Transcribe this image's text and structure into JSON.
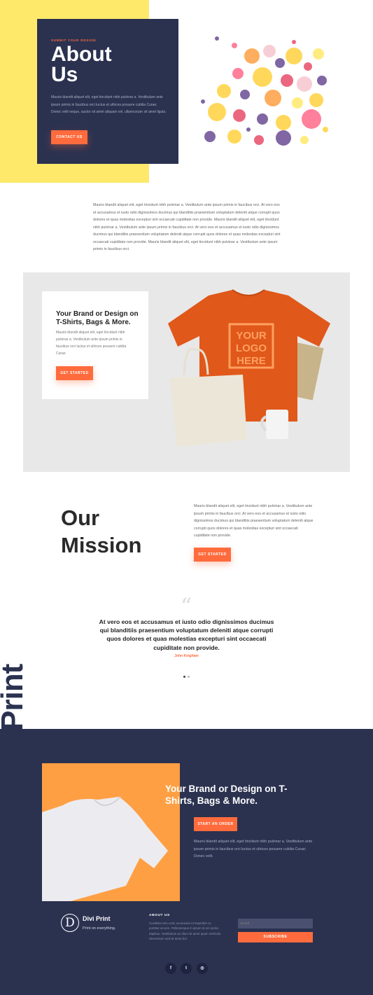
{
  "hero": {
    "eyebrow": "SUBMIT YOUR DESIGN",
    "title": "About Us",
    "text": "Mauris blandit aliquet elit, eget tincidunt nibh pulvinar a. Vestibulum ante ipsum primis in faucibus orci luctus et ultrices posuere cubilia Curae; Donec velit neque, auctor sit amet aliquam vel, ullamcorper sit amet ligula.",
    "button": "CONTACT US"
  },
  "intro": {
    "text": "Mauris blandit aliquet elit, eget tincidunt nibh pulvinar a. Vestibulum ante ipsum primis in faucibus orci. At vero eos et accusamus et iusto odio dignissimos ducimus qui blanditiis praesentium voluptatum deleniti atque corrupti quos dolores et quas molestias excepturi sint occaecati cupiditate non provide. Mauris blandit aliquet elit, eget tincidunt nibh pulvinar a. Vestibulum ante ipsum primis in faucibus orci. At vero eos et accusamus et iusto odio dignissimos ducimus qui blanditiis praesentium voluptatum deleniti atque corrupti quos dolores et quas molestias excepturi sint occaecati cupiditate non provide. Mauris blandit aliquet elit, eget tincidunt nibh pulvinar a. Vestibulum ante ipsum primis in faucibus orci."
  },
  "brand_card": {
    "title": "Your Brand or Design on T-Shirts, Bags & More.",
    "text": "Mauris blandit aliquet elit, eget tincidunt nibh pulvinar a. Vestibulum ante ipsum primis in faucibus orci luctus et ultrices posuere cubilia Curae",
    "button": "GET STARTED",
    "shirt_logo": [
      "YOUR",
      "LOGO",
      "HERE"
    ]
  },
  "mission": {
    "title": "Our Mission",
    "text": "Mauris blandit aliquet elit, eget tincidunt nibh pulvinar a. Vestibulum ante ipsum primis in faucibus orci. At vero eos et accusamus et iusto odio dignissimos ducimus qui blanditiis praesentium voluptatum deleniti atque corrupti quos dolores et quas molestias excepturi sint occaecati cupiditate non provide.",
    "button": "GET STARTED"
  },
  "testimonial": {
    "quote_mark": "“",
    "quote": "At vero eos et accusamus et iusto odio dignissimos ducimus qui blanditiis praesentium voluptatum deleniti atque corrupti quos dolores et quas molestias excepturi sint occaecati cupiditate non provide.",
    "author": "John Kingham"
  },
  "side_word": "Print",
  "cta": {
    "title": "Your Brand or Design on T-Shirts, Bags & More.",
    "button": "START AN ORDER",
    "text": "Mauris blandit aliquet elit, eget tincidunt nibh pulvinar a. Vestibulum ante ipsum primis in faucibus orci luctus et ultrices posuere cubilia Curae; Donec velit."
  },
  "footer": {
    "logo_letter": "D",
    "brand_name": "Divi Print",
    "tagline": "Print on everything.",
    "about_heading": "ABOUT US",
    "about_text": "Curabitur arcu erat, accumsan id imperdiet et, porttitor at sem. Pellentesque in ipsum id orci porta dapibus. Vestibulum ac diam sit amet quam vehicula elementum sed sit amet dui.",
    "email_placeholder": "Email",
    "subscribe": "SUBSCRIBE",
    "social": [
      {
        "icon": "facebook-icon",
        "glyph": "f"
      },
      {
        "icon": "twitter-icon",
        "glyph": "t"
      },
      {
        "icon": "instagram-icon",
        "glyph": "◎"
      }
    ]
  },
  "colors": {
    "accent": "#ff6b3d",
    "navy": "#2b3250",
    "yellow": "#ffe96b",
    "orange": "#ff9f43"
  }
}
